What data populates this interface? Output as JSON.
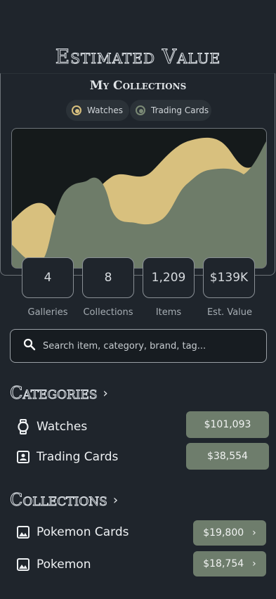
{
  "header": {
    "title": "Estimated Value",
    "subtitle": "My Collections"
  },
  "legend": [
    {
      "label": "Watches",
      "color": "#d8c07e"
    },
    {
      "label": "Trading Cards",
      "color": "#7b8a76"
    }
  ],
  "chart_data": {
    "type": "area",
    "grid": false,
    "series": [
      {
        "name": "Watches",
        "color": "#d8c07e"
      },
      {
        "name": "Trading Cards",
        "color": "#6e7c69"
      }
    ]
  },
  "stats": [
    {
      "value": "4",
      "label": "Galleries"
    },
    {
      "value": "8",
      "label": "Collections"
    },
    {
      "value": "1,209",
      "label": "Items"
    },
    {
      "value": "$139K",
      "label": "Est. Value"
    }
  ],
  "search": {
    "placeholder": "Search item, category, brand, tag..."
  },
  "categories": {
    "title": "Categories",
    "items": [
      {
        "label": "Watches",
        "value": "$101,093",
        "icon": "watch-icon"
      },
      {
        "label": "Trading Cards",
        "value": "$38,554",
        "icon": "card-icon"
      }
    ]
  },
  "collections": {
    "title": "Collections",
    "items": [
      {
        "label": "Pokemon Cards",
        "value": "$19,800",
        "icon": "image-icon"
      },
      {
        "label": "Pokemon",
        "value": "$18,754",
        "icon": "image-icon"
      }
    ]
  }
}
